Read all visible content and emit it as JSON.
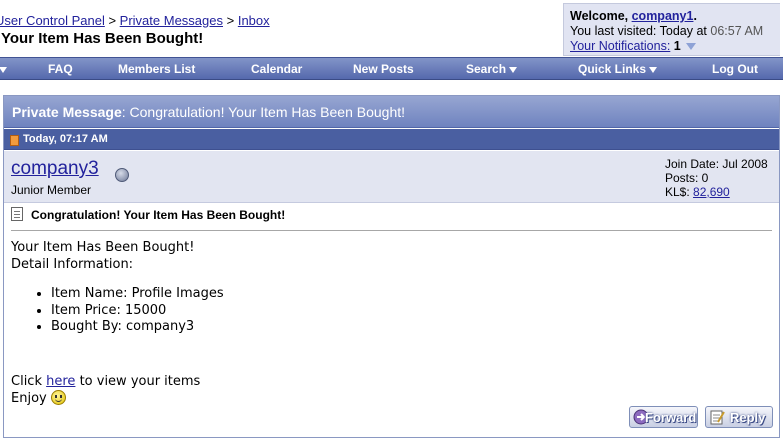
{
  "breadcrumb": {
    "items": [
      "User Control Panel",
      "Private Messages",
      "Inbox"
    ],
    "separator": ">"
  },
  "page_title": "Your Item Has Been Bought!",
  "welcome": {
    "prefix": "Welcome,",
    "username": "company1",
    "suffix": ".",
    "last_visited_label": "You last visited: Today at",
    "last_visited_time": "06:57 AM",
    "notifications_label": "Your Notifications:",
    "notifications_count": "1"
  },
  "navbar": {
    "items": [
      "FAQ",
      "Members List",
      "Calendar",
      "New Posts",
      "Search",
      "Quick Links",
      "Log Out"
    ]
  },
  "message": {
    "header_bold": "Private Message",
    "header_rest": ": Congratulation! Your Item Has Been Bought!",
    "date": "Today, 07:17 AM",
    "author": "company3",
    "author_title": "Junior Member",
    "join_date": "Join Date: Jul 2008",
    "posts": "Posts: 0",
    "kl_label": "KL$:",
    "kl_value": "82,690",
    "subject": "Congratulation! Your Item Has Been Bought!",
    "body_line1": "Your Item Has Been Bought!",
    "body_line2": "Detail Information:",
    "details": [
      "Item Name: Profile Images",
      "Item Price: 15000",
      "Bought By: company3"
    ],
    "click_prefix": "Click",
    "click_link": "here",
    "click_suffix": "to view your items",
    "enjoy": "Enjoy"
  },
  "buttons": {
    "forward": "Forward",
    "reply": "Reply"
  },
  "colors": {
    "nav_bar": "#5569ad",
    "header_bar": "#6f83bf",
    "link": "#22229c",
    "user_bar": "#e2e5f1"
  }
}
